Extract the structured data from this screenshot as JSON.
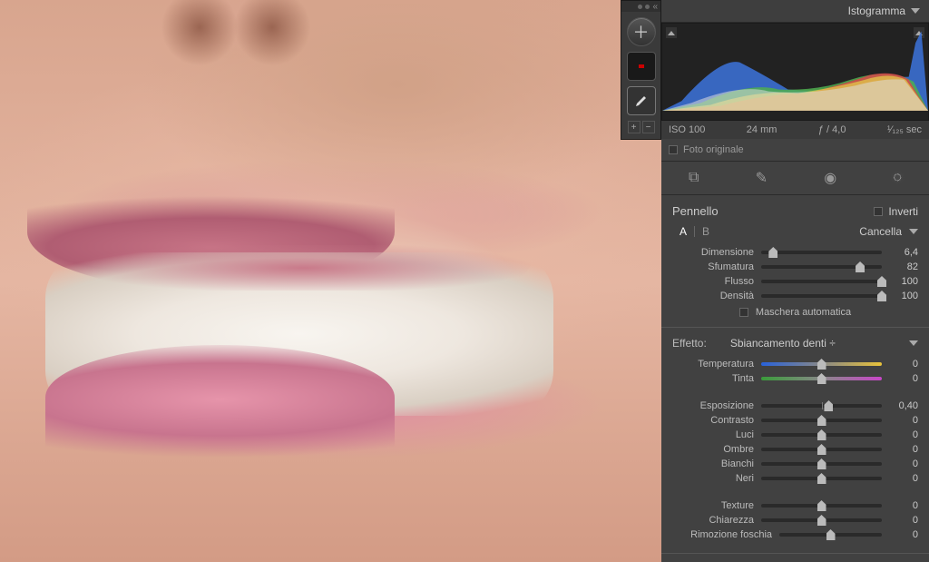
{
  "header": {
    "histogram_label": "Istogramma"
  },
  "exif": {
    "iso": "ISO 100",
    "focal": "24 mm",
    "aperture": "ƒ / 4,0",
    "shutter": "¹⁄₁₂₅ sec"
  },
  "original": {
    "label": "Foto originale"
  },
  "brush": {
    "panel_label": "Pennello",
    "invert_label": "Inverti",
    "a": "A",
    "b": "B",
    "cancel": "Cancella",
    "size_label": "Dimensione",
    "size_val": "6,4",
    "feather_label": "Sfumatura",
    "feather_val": "82",
    "flow_label": "Flusso",
    "flow_val": "100",
    "density_label": "Densità",
    "density_val": "100",
    "automask_label": "Maschera automatica"
  },
  "effect": {
    "label": "Effetto:",
    "value": "Sbiancamento denti",
    "chev": "÷"
  },
  "sliders": {
    "temp_label": "Temperatura",
    "temp_val": "0",
    "tint_label": "Tinta",
    "tint_val": "0",
    "exposure_label": "Esposizione",
    "exposure_val": "0,40",
    "contrast_label": "Contrasto",
    "contrast_val": "0",
    "highlights_label": "Luci",
    "highlights_val": "0",
    "shadows_label": "Ombre",
    "shadows_val": "0",
    "whites_label": "Bianchi",
    "whites_val": "0",
    "blacks_label": "Neri",
    "blacks_val": "0",
    "texture_label": "Texture",
    "texture_val": "0",
    "clarity_label": "Chiarezza",
    "clarity_val": "0",
    "dehaze_label": "Rimozione foschia",
    "dehaze_val": "0"
  }
}
